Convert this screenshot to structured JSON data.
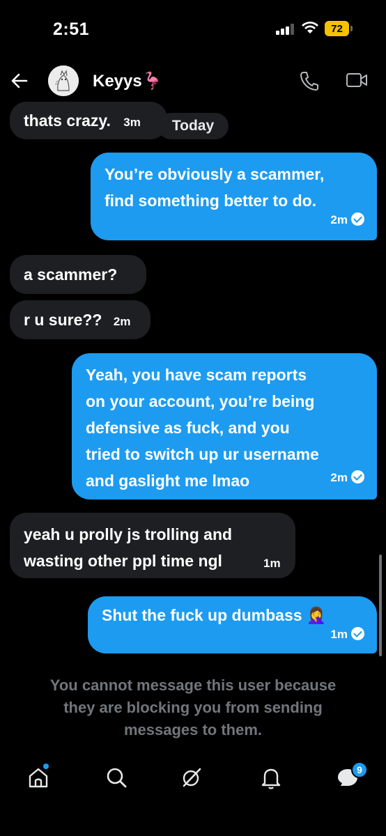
{
  "status_bar": {
    "time": "2:51",
    "battery": "72",
    "battery_color": "#f3c200"
  },
  "header": {
    "contact_name": "Keyys🦩"
  },
  "conversation": {
    "today_label": "Today",
    "messages": [
      {
        "direction": "incoming",
        "text": "thats crazy.",
        "time": "3m"
      },
      {
        "direction": "outgoing",
        "text": "You’re obviously a scammer,\nfind something better to do.",
        "time": "2m",
        "read": true
      },
      {
        "direction": "incoming",
        "text": "a scammer?",
        "time": ""
      },
      {
        "direction": "incoming",
        "text": "r u sure??",
        "time": "2m"
      },
      {
        "direction": "outgoing",
        "text": "Yeah, you have scam reports\non your account, you’re being\ndefensive as fuck, and you\ntried to switch up ur username\nand gaslight me lmao",
        "time": "2m",
        "read": true
      },
      {
        "direction": "incoming",
        "text": "yeah u prolly js trolling and\nwasting other ppl time ngl",
        "time": "1m"
      },
      {
        "direction": "outgoing",
        "text": "Shut the fuck up dumbass 🤦‍♀️",
        "time": "1m",
        "read": true
      }
    ],
    "blocked_notice": "You cannot message this user because\nthey are blocking you from sending\nmessages to them."
  },
  "bottom_nav": {
    "items": [
      "home",
      "search",
      "grok",
      "notifications",
      "messages"
    ],
    "messages_badge": "9"
  },
  "colors": {
    "accent": "#1d9bf0",
    "incoming_bubble": "#1e1f22",
    "muted_text": "#71767b"
  },
  "icons": [
    "back-arrow-icon",
    "phone-icon",
    "video-icon",
    "home-icon",
    "search-icon",
    "grok-icon",
    "bell-icon",
    "messages-icon"
  ]
}
